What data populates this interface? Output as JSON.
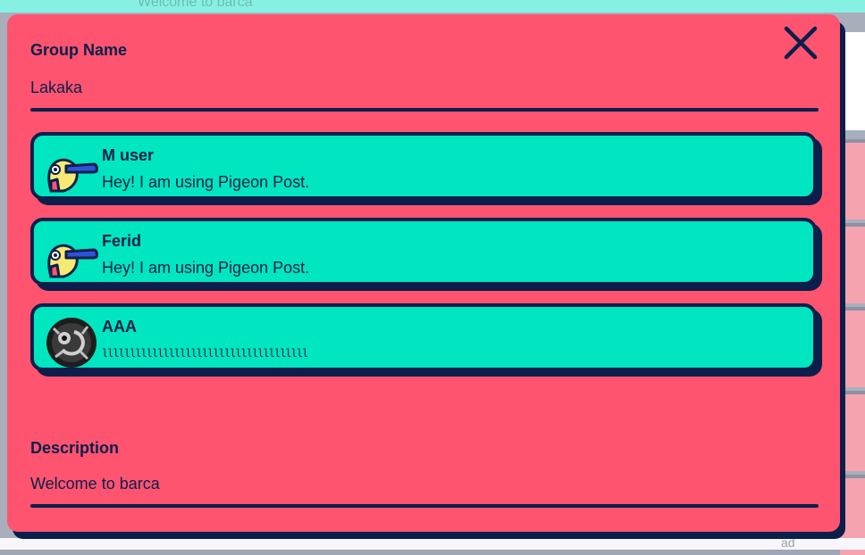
{
  "background": {
    "top_text": "Welcome to barca",
    "bottom_fragment": "ad"
  },
  "modal": {
    "group_name": {
      "label": "Group Name",
      "value": "Lakaka"
    },
    "description": {
      "label": "Description",
      "value": "Welcome to barca"
    },
    "close_icon": "close-icon",
    "members": [
      {
        "name": "M user",
        "status": "Hey! I am using Pigeon Post.",
        "avatar": "pigeon-avatar-icon"
      },
      {
        "name": "Ferid",
        "status": "Hey! I am using Pigeon Post.",
        "avatar": "pigeon-avatar-icon"
      },
      {
        "name": "AAA",
        "status": "lllllllllllllllllllllllllllllllllllll",
        "avatar": "photo-avatar"
      }
    ]
  },
  "colors": {
    "modal_bg": "#ff5470",
    "card_bg": "#00e6c0",
    "ink": "#0b1f4a",
    "bg_top": "#86f1e2"
  }
}
